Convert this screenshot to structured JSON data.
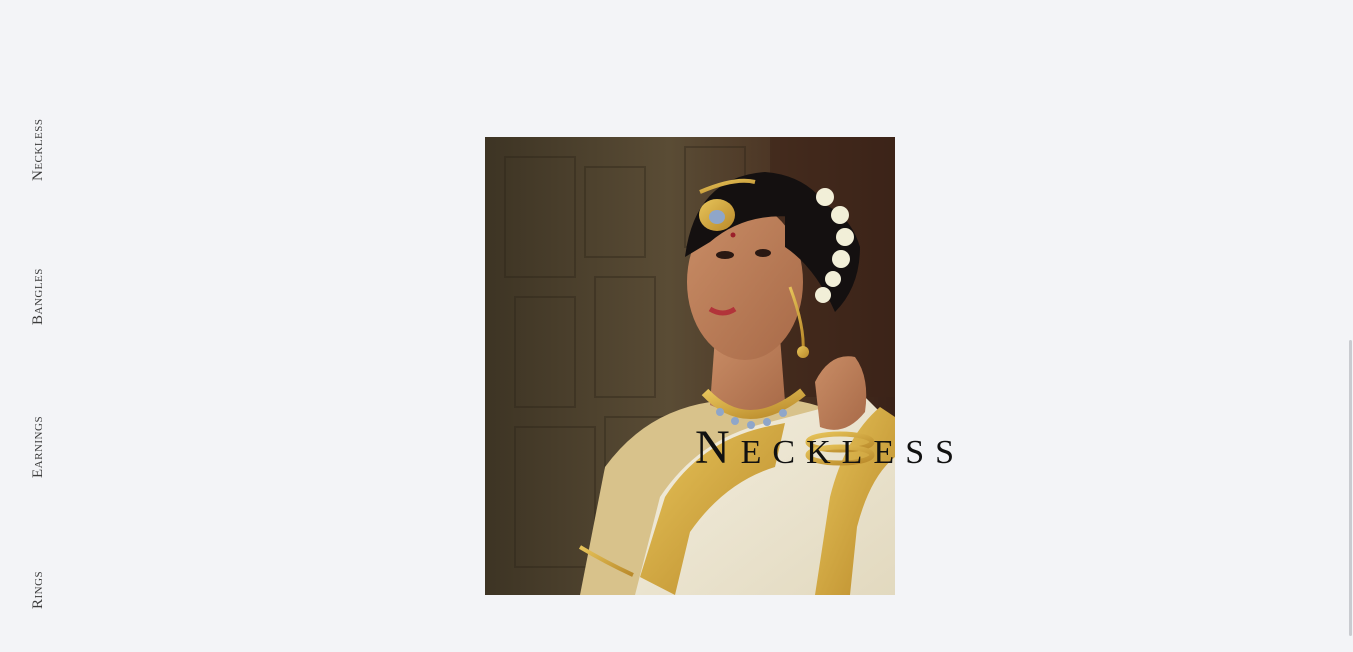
{
  "nav": {
    "items": [
      {
        "label": "Neckless"
      },
      {
        "label": "Bangles"
      },
      {
        "label": "Earnings"
      },
      {
        "label": "Rings"
      }
    ]
  },
  "hero": {
    "title": "Neckless"
  },
  "colors": {
    "background": "#f3f4f7",
    "text": "#111111",
    "nav_text": "#3b3b3b",
    "gold": "#c9a13b",
    "saree_white": "#efe9d6"
  }
}
